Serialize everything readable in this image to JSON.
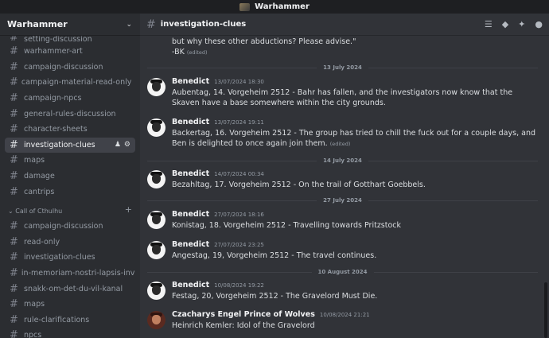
{
  "window": {
    "title": "Warhammer"
  },
  "sidebar": {
    "server_name": "Warhammer",
    "channels_top": [
      {
        "label": "setting-discussion",
        "cut": true
      },
      {
        "label": "warhammer-art"
      },
      {
        "label": "campaign-discussion"
      },
      {
        "label": "campaign-material-read-only"
      },
      {
        "label": "campaign-npcs"
      },
      {
        "label": "general-rules-discussion"
      },
      {
        "label": "character-sheets"
      },
      {
        "label": "investigation-clues",
        "active": true
      },
      {
        "label": "maps"
      },
      {
        "label": "damage"
      },
      {
        "label": "cantrips"
      }
    ],
    "category": "Call of Cthulhu",
    "channels_coc": [
      {
        "label": "campaign-discussion"
      },
      {
        "label": "read-only"
      },
      {
        "label": "investigation-clues"
      },
      {
        "label": "in-memoriam-nostri-lapsis-inve..."
      },
      {
        "label": "snakk-om-det-du-vil-kanal"
      },
      {
        "label": "maps"
      },
      {
        "label": "rule-clarifications"
      },
      {
        "label": "npcs"
      }
    ]
  },
  "main": {
    "channel_name": "investigation-clues",
    "header_icons": [
      "threads-icon",
      "bell-icon",
      "pin-icon",
      "members-icon"
    ],
    "top_text": {
      "line1": "but why these other abductions? Please advise.\"",
      "line2": "-BK",
      "edited": "(edited)"
    },
    "dividers": [
      "13 July 2024",
      "14 July 2024",
      "27 July 2024",
      "10 August 2024"
    ],
    "messages": [
      {
        "author": "Benedict",
        "time": "13/07/2024 18:30",
        "text": "Aubentag, 14. Vorgeheim 2512 - Bahr has fallen, and the investigators now know that the Skaven have a base somewhere within the city grounds."
      },
      {
        "author": "Benedict",
        "time": "13/07/2024 19:11",
        "text": "Backertag, 16. Vorgeheim 2512 - The group has tried to chill the fuck out for a couple days, and Ben is delighted to once again join them.",
        "edited": "(edited)"
      },
      {
        "author": "Benedict",
        "time": "14/07/2024 00:34",
        "text": "Bezahltag, 17. Vorgeheim 2512 - On the trail of Gotthart Goebbels."
      },
      {
        "author": "Benedict",
        "time": "27/07/2024 18:16",
        "text": "Konistag, 18. Vorgeheim 2512 - Travelling towards Pritzstock"
      },
      {
        "author": "Benedict",
        "time": "27/07/2024 23:25",
        "text": "Angestag, 19, Vorgeheim 2512 - The travel continues."
      },
      {
        "author": "Benedict",
        "time": "10/08/2024 19:22",
        "text": "Festag, 20, Vorgeheim 2512 - The Gravelord Must Die."
      },
      {
        "author": "Czacharys Engel Prince of Wolves",
        "time": "10/08/2024 21:21",
        "text": "Heinrich Kemler: Idol of the Gravelord"
      }
    ]
  }
}
